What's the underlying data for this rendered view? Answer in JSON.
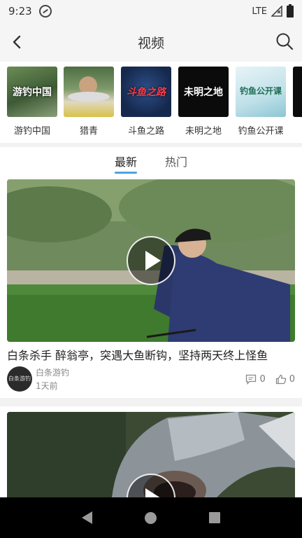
{
  "status_bar": {
    "time": "9:23",
    "network": "LTE"
  },
  "header": {
    "title": "视频"
  },
  "channels": [
    {
      "label": "游钓中国",
      "thumb_text": "游钓中国"
    },
    {
      "label": "猎青",
      "thumb_text": ""
    },
    {
      "label": "斗鱼之路",
      "thumb_text": "斗鱼之路"
    },
    {
      "label": "未明之地",
      "thumb_text": "未明之地"
    },
    {
      "label": "钓鱼公开课",
      "thumb_text": "钓鱼公开课"
    }
  ],
  "tabs": [
    {
      "label": "最新",
      "active": true
    },
    {
      "label": "热门",
      "active": false
    }
  ],
  "feed": [
    {
      "title": "白条杀手 醉翁亭，突遇大鱼断钩，坚持两天终上怪鱼",
      "author": "白条游钓",
      "avatar_text": "白条游钓",
      "time_ago": "1天前",
      "comments": "0",
      "likes": "0"
    },
    {
      "title": "",
      "author": "",
      "time_ago": "",
      "comments": "",
      "likes": ""
    }
  ],
  "colors": {
    "tab_underline": "#4da3e0",
    "nav_bar": "#000000"
  }
}
